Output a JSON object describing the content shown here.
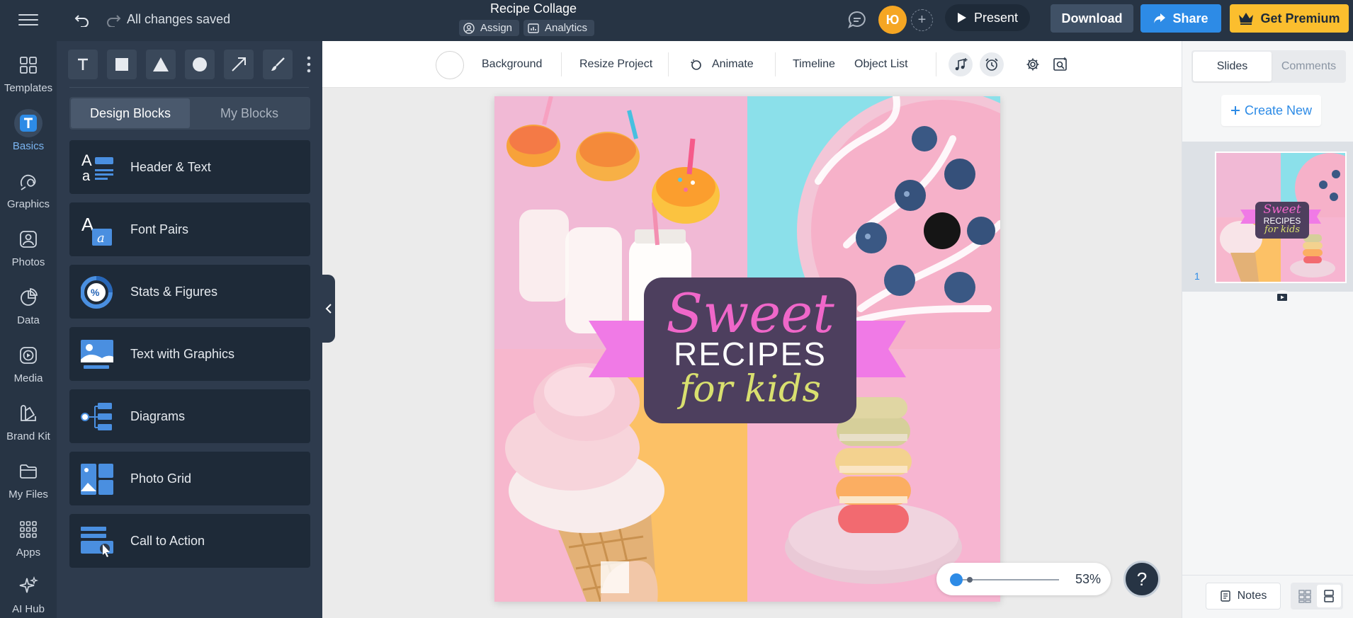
{
  "topbar": {
    "save_status": "All changes saved",
    "document_title": "Recipe Collage",
    "assign_label": "Assign",
    "analytics_label": "Analytics",
    "user_initials": "Ю",
    "present_label": "Present",
    "download_label": "Download",
    "share_label": "Share",
    "premium_label": "Get Premium",
    "colors": {
      "bar": "#273444",
      "share": "#2d8be6",
      "premium": "#fbbe2e",
      "avatar": "#f5a623"
    }
  },
  "rail": {
    "items": [
      {
        "label": "Templates",
        "icon": "templates-icon"
      },
      {
        "label": "Basics",
        "icon": "text-t-icon",
        "active": true
      },
      {
        "label": "Graphics",
        "icon": "graphics-icon"
      },
      {
        "label": "Photos",
        "icon": "photos-icon"
      },
      {
        "label": "Data",
        "icon": "pie-chart-icon"
      },
      {
        "label": "Media",
        "icon": "media-play-icon"
      },
      {
        "label": "Brand Kit",
        "icon": "brand-kit-icon"
      },
      {
        "label": "My Files",
        "icon": "folder-icon"
      },
      {
        "label": "Apps",
        "icon": "apps-grid-icon"
      },
      {
        "label": "AI Hub",
        "icon": "sparkle-icon"
      }
    ]
  },
  "panel": {
    "tools": [
      "text-tool-icon",
      "square-tool-icon",
      "triangle-tool-icon",
      "circle-tool-icon",
      "arrow-tool-icon",
      "brush-tool-icon"
    ],
    "tabs": {
      "active": "Design Blocks",
      "inactive": "My Blocks"
    },
    "blocks": [
      {
        "label": "Header & Text",
        "icon": "header-text-icon"
      },
      {
        "label": "Font Pairs",
        "icon": "font-pairs-icon"
      },
      {
        "label": "Stats & Figures",
        "icon": "stats-icon"
      },
      {
        "label": "Text with Graphics",
        "icon": "text-graphics-icon"
      },
      {
        "label": "Diagrams",
        "icon": "diagram-icon"
      },
      {
        "label": "Photo Grid",
        "icon": "photo-grid-icon"
      },
      {
        "label": "Call to Action",
        "icon": "call-to-action-icon"
      }
    ]
  },
  "canvas_toolbar": {
    "background_label": "Background",
    "resize_label": "Resize Project",
    "animate_label": "Animate",
    "timeline_label": "Timeline",
    "object_list_label": "Object List"
  },
  "design": {
    "line1": "Sweet",
    "line2": "RECIPES",
    "line3": "for kids",
    "colors": {
      "card": "#4d3f5e",
      "ribbon": "#f07ae6",
      "sweet": "#ef67c9",
      "kids": "#d9e06f"
    }
  },
  "zoom": {
    "value": "53%"
  },
  "help": {
    "label": "?"
  },
  "right_panel": {
    "tabs": {
      "active": "Slides",
      "inactive": "Comments"
    },
    "create_new_label": "Create New",
    "slides": [
      {
        "number": "1",
        "line1": "Sweet",
        "line2": "RECIPES",
        "line3": "for kids"
      }
    ],
    "notes_label": "Notes"
  }
}
